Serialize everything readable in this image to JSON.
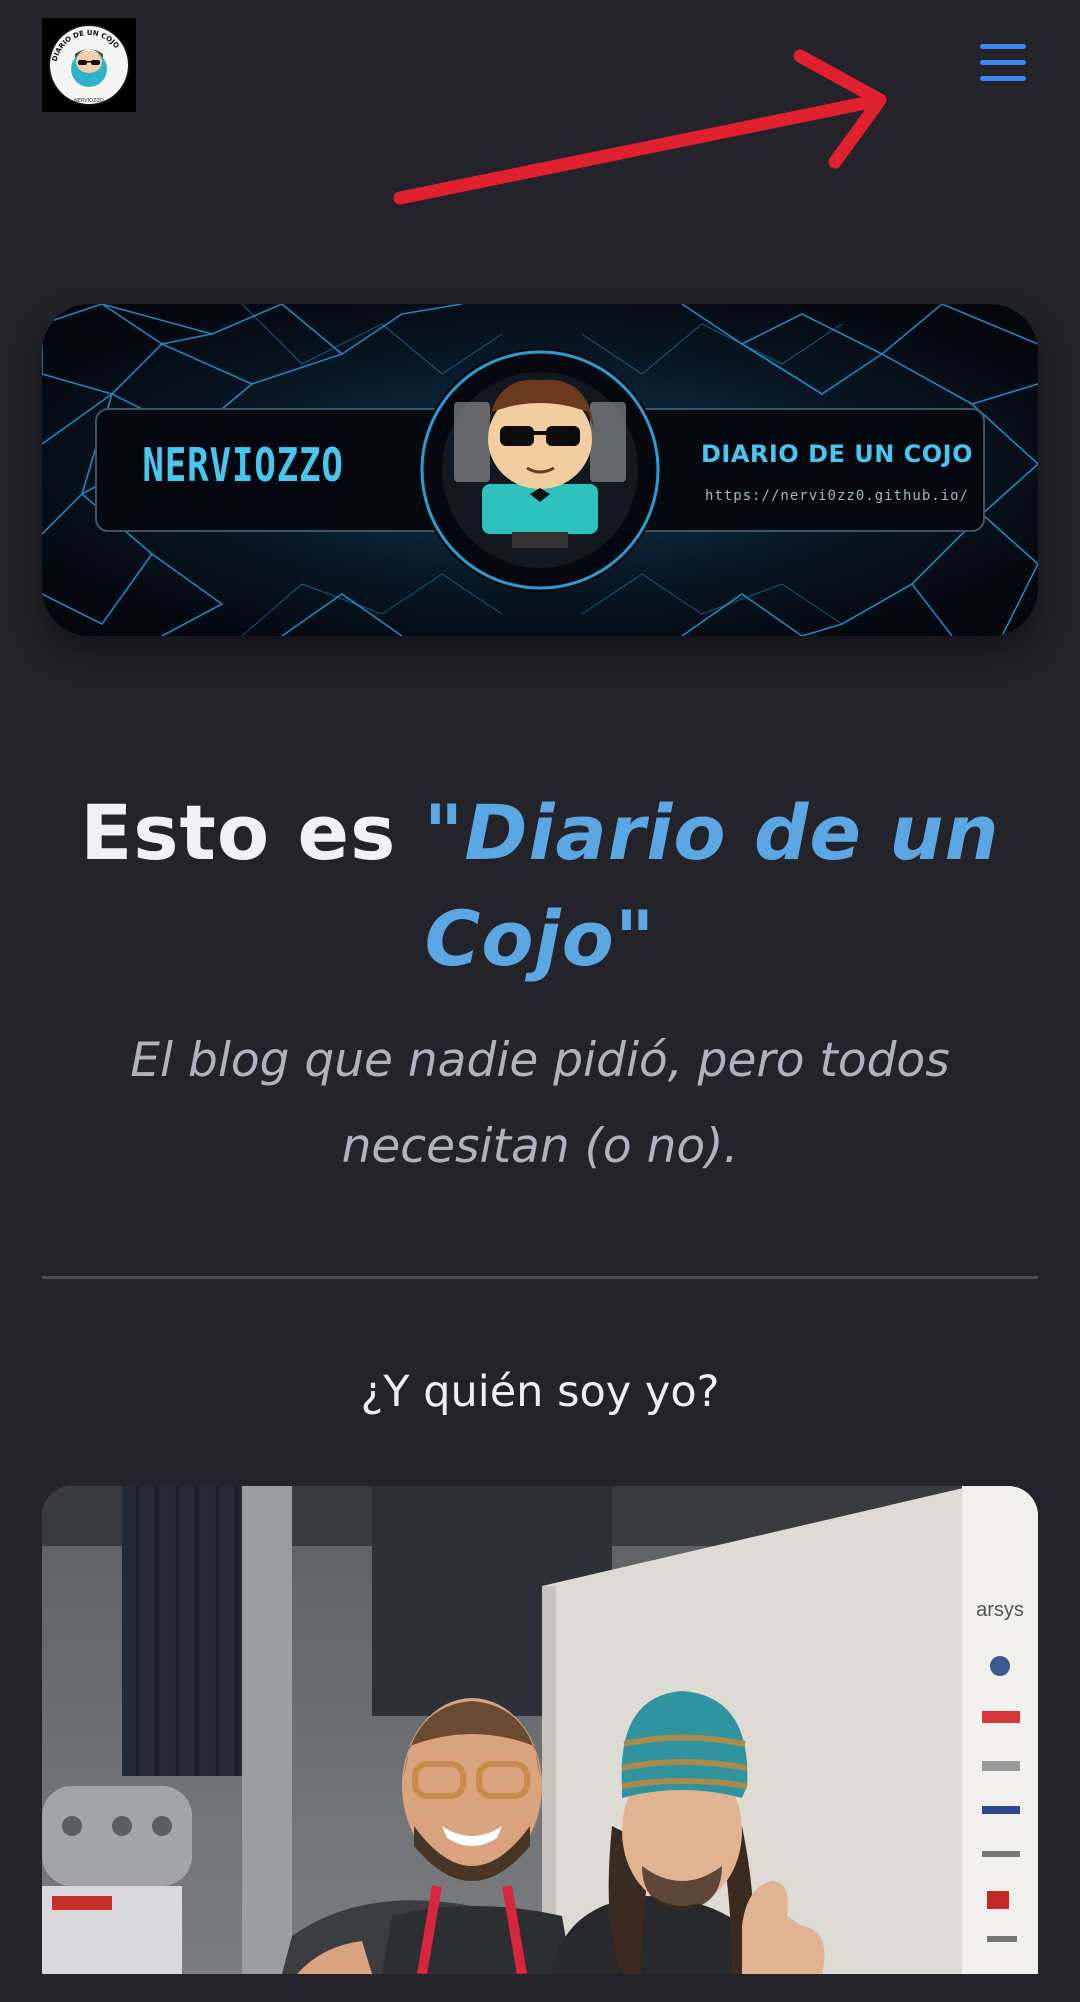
{
  "header": {
    "logo_text": "DIARIO DE UN COJO",
    "logo_subtext": "NERVIOZZO",
    "menu_icon": "hamburger-menu-icon",
    "menu_color": "#3f86ef",
    "annotation_color": "#e0202f"
  },
  "banner": {
    "left_text": "NERVIOZZO",
    "right_title": "DIARIO DE UN COJO",
    "right_url": "https://nervi0zz0.github.io/",
    "accent_color": "#48c6ee"
  },
  "hero": {
    "title_prefix": "Esto es ",
    "title_highlight": "\"Diario de un Cojo\"",
    "tagline": "El blog que nadie pidió, pero todos necesitan (o no)."
  },
  "about": {
    "heading": "¿Y quién soy yo?",
    "photo_sign_text": "arsys"
  },
  "colors": {
    "background": "#242329",
    "accent": "#5aa7e4",
    "text": "#f0f1f5",
    "muted": "#aeb3bf"
  }
}
